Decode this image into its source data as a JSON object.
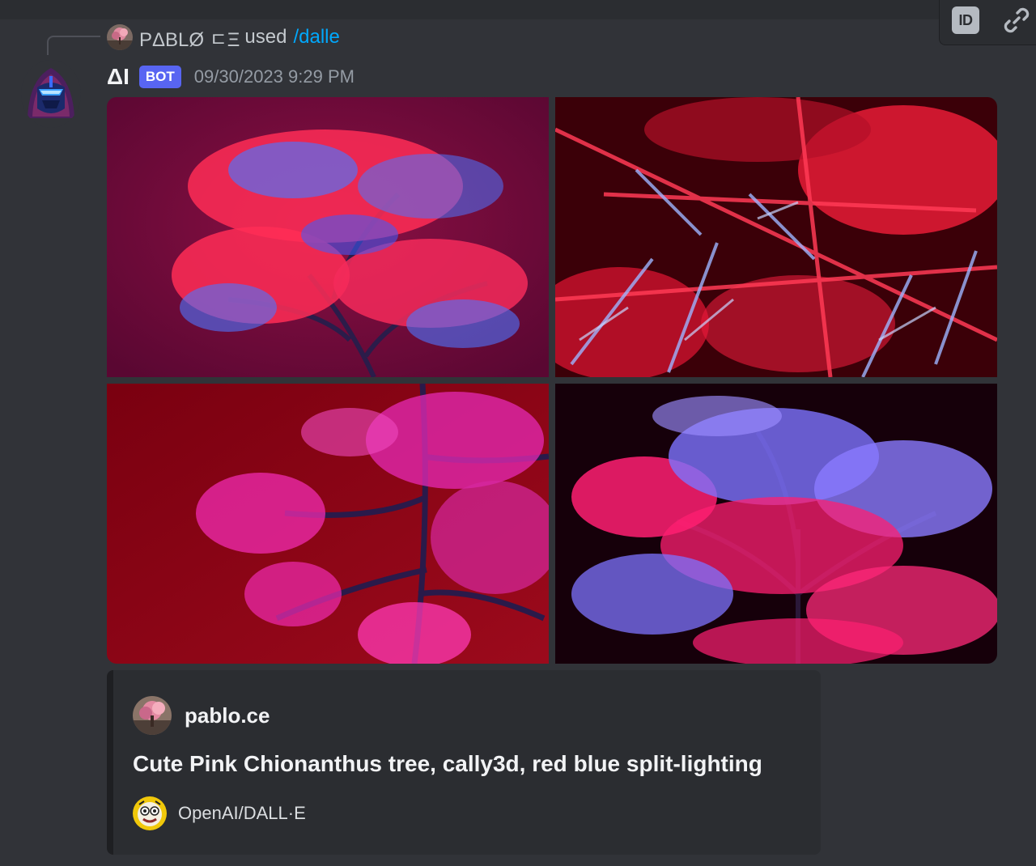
{
  "reply": {
    "username": "PΔBLØ ㄷΞ",
    "used_text": "used",
    "command": "/dalle"
  },
  "message": {
    "username": "ΔI",
    "bot_tag": "BOT",
    "timestamp": "09/30/2023 9:29 PM"
  },
  "images": [
    {
      "name": "generated-image-1",
      "palette": [
        "#6d0a3a",
        "#ff2c55",
        "#3f6cff"
      ]
    },
    {
      "name": "generated-image-2",
      "palette": [
        "#3b0008",
        "#ff2440",
        "#8aa8ff"
      ]
    },
    {
      "name": "generated-image-3",
      "palette": [
        "#7a0010",
        "#f02bb0",
        "#2a1a4a"
      ]
    },
    {
      "name": "generated-image-4",
      "palette": [
        "#16000a",
        "#ff1f72",
        "#7d73ff"
      ]
    }
  ],
  "embed": {
    "author_name": "pablo.ce",
    "title": "Cute Pink Chionanthus tree, cally3d, red blue split-lighting",
    "footer_text": "OpenAI/DALL·E"
  },
  "toolbar": {
    "id_label": "ID"
  },
  "colors": {
    "background": "#313338",
    "command_link": "#00a8fc",
    "bot_tag": "#5865f2",
    "embed_background": "#2b2d31"
  }
}
